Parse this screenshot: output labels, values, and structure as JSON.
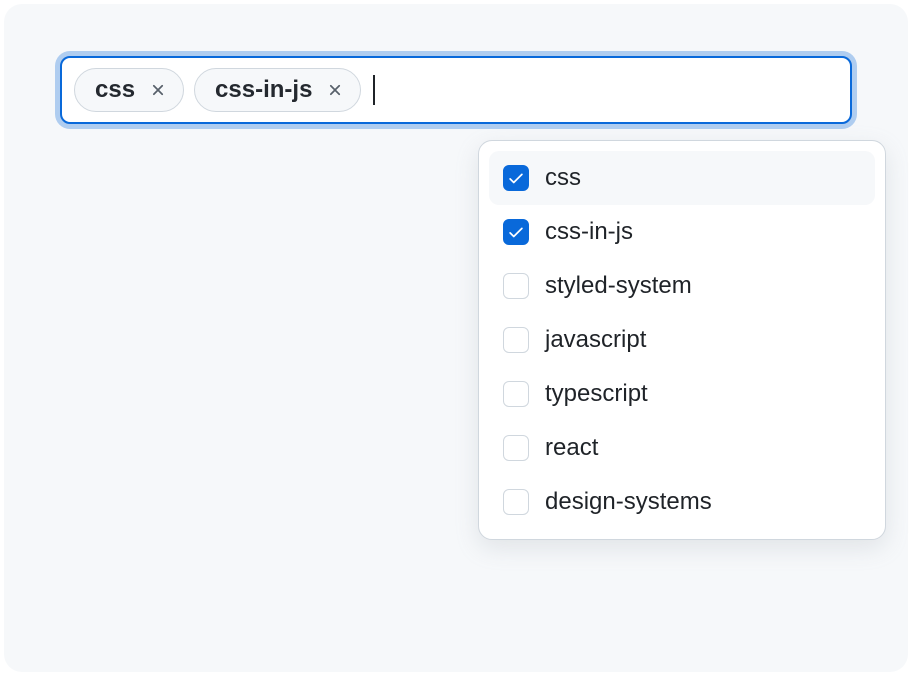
{
  "input": {
    "selected_tags": [
      {
        "label": "css"
      },
      {
        "label": "css-in-js"
      }
    ],
    "value": ""
  },
  "dropdown": {
    "options": [
      {
        "label": "css",
        "checked": true,
        "highlighted": true
      },
      {
        "label": "css-in-js",
        "checked": true,
        "highlighted": false
      },
      {
        "label": "styled-system",
        "checked": false,
        "highlighted": false
      },
      {
        "label": "javascript",
        "checked": false,
        "highlighted": false
      },
      {
        "label": "typescript",
        "checked": false,
        "highlighted": false
      },
      {
        "label": "react",
        "checked": false,
        "highlighted": false
      },
      {
        "label": "design-systems",
        "checked": false,
        "highlighted": false
      }
    ]
  }
}
